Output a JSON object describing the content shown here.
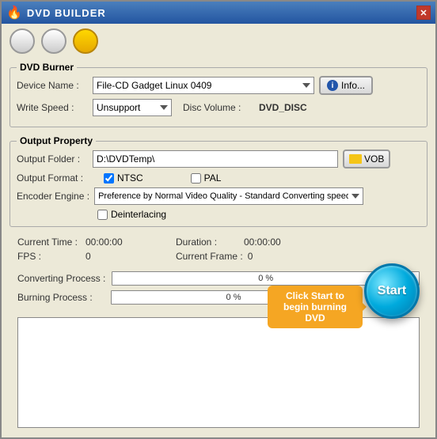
{
  "window": {
    "title": "DVD BUILDER",
    "close_btn": "✕"
  },
  "toolbar": {
    "btn1_active": false,
    "btn2_active": false,
    "btn3_active": true
  },
  "dvd_burner": {
    "group_label": "DVD Burner",
    "device_name_label": "Device Name :",
    "device_name_value": "File-CD Gadget  Linux   0409",
    "info_btn_label": "Info...",
    "write_speed_label": "Write Speed :",
    "write_speed_value": "Unsupport",
    "disc_volume_label": "Disc Volume :",
    "disc_volume_value": "DVD_DISC"
  },
  "output_property": {
    "group_label": "Output Property",
    "output_folder_label": "Output Folder :",
    "output_folder_value": "D:\\DVDTemp\\",
    "vob_btn_label": "VOB",
    "output_format_label": "Output Format :",
    "ntsc_label": "NTSC",
    "ntsc_checked": true,
    "pal_label": "PAL",
    "pal_checked": false,
    "encoder_engine_label": "Encoder Engine :",
    "encoder_engine_value": "Preference by Normal Video Quality - Standard Converting speed",
    "deinterlacing_label": "Deinterlacing",
    "deinterlacing_checked": false
  },
  "stats": {
    "current_time_label": "Current Time :",
    "current_time_value": "00:00:00",
    "duration_label": "Duration :",
    "duration_value": "00:00:00",
    "fps_label": "FPS :",
    "fps_value": "0",
    "current_frame_label": "Current Frame :",
    "current_frame_value": "0"
  },
  "progress": {
    "converting_label": "Converting Process :",
    "converting_pct": "0 %",
    "converting_fill": 0,
    "burning_label": "Burning Process :",
    "burning_pct": "0 %",
    "burning_fill": 0
  },
  "start_btn": {
    "label": "Start",
    "tooltip": "Click Start to begin burning DVD"
  },
  "log": {
    "content": ""
  }
}
